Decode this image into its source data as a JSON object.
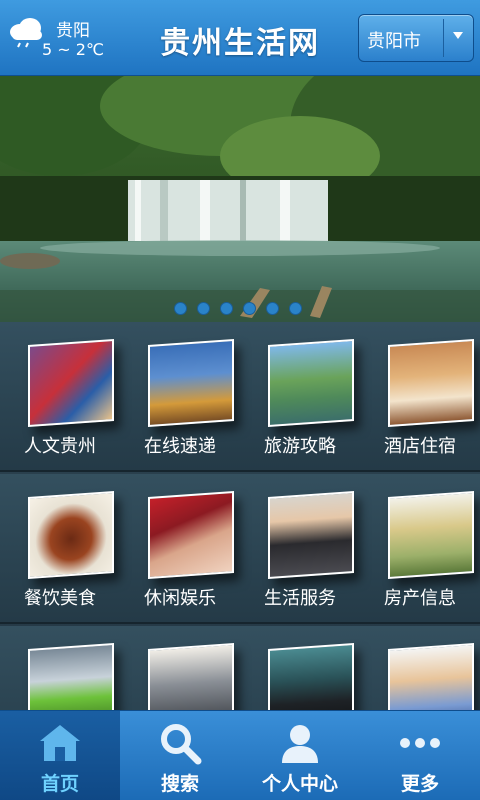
{
  "header": {
    "weather": {
      "icon": "cloud-rain-icon",
      "city": "贵阳",
      "temp": "5 ~ 2℃"
    },
    "title": "贵州生活网",
    "city_select": {
      "value": "贵阳市",
      "icon": "chevron-down-icon"
    }
  },
  "banner": {
    "image": "waterfall-lake-photo",
    "page_count": 6,
    "active_page": 4
  },
  "grid": {
    "rows": [
      {
        "items": [
          {
            "label": "人文贵州",
            "icon": "folk-culture-photo"
          },
          {
            "label": "在线速递",
            "icon": "city-skyline-photo"
          },
          {
            "label": "旅游攻略",
            "icon": "pavilion-bridge-photo"
          },
          {
            "label": "酒店住宿",
            "icon": "hotel-room-photo"
          }
        ]
      },
      {
        "items": [
          {
            "label": "餐饮美食",
            "icon": "food-dish-photo"
          },
          {
            "label": "休闲娱乐",
            "icon": "spa-massage-photo"
          },
          {
            "label": "生活服务",
            "icon": "service-staff-photo"
          },
          {
            "label": "房产信息",
            "icon": "apartment-buildings-photo"
          }
        ]
      },
      {
        "items": [
          {
            "label": "",
            "icon": "green-car-photo"
          },
          {
            "label": "",
            "icon": "street-city-photo"
          },
          {
            "label": "",
            "icon": "businessman-photo"
          },
          {
            "label": "",
            "icon": "young-people-photo"
          }
        ]
      }
    ]
  },
  "tabbar": {
    "tabs": [
      {
        "label": "首页",
        "icon": "home-icon",
        "active": true
      },
      {
        "label": "搜索",
        "icon": "search-icon",
        "active": false
      },
      {
        "label": "个人中心",
        "icon": "user-icon",
        "active": false
      },
      {
        "label": "更多",
        "icon": "more-dots-icon",
        "active": false
      }
    ]
  },
  "colors": {
    "accent": "#2a83c9",
    "active_tab_text": "#6fd2ff"
  }
}
